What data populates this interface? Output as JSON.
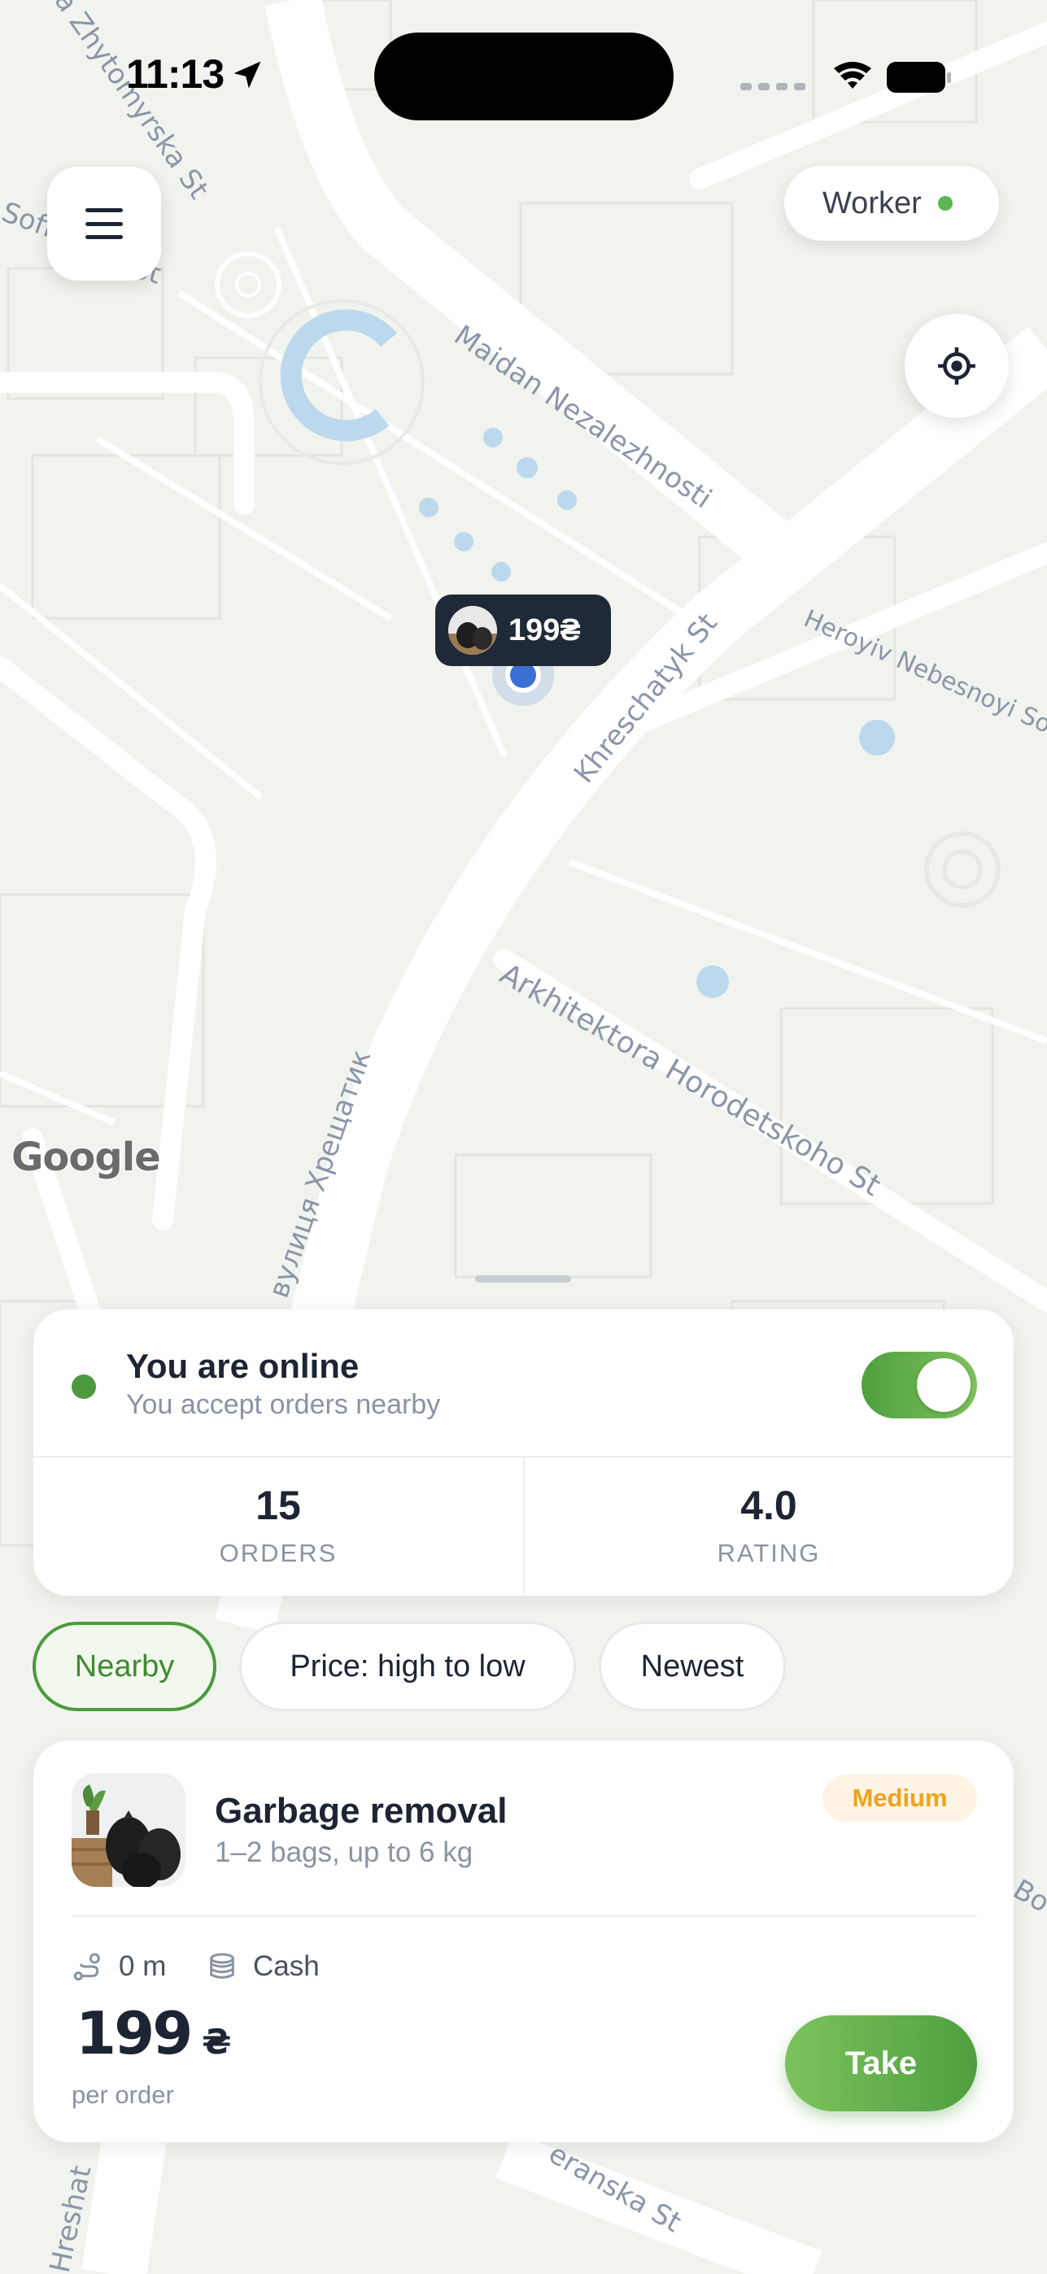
{
  "status_bar": {
    "time": "11:13"
  },
  "header": {
    "role_label": "Worker"
  },
  "map": {
    "streets": [
      "Maidan Nezalezhnosti",
      "Khreschatyk St",
      "Heroyiv Nebesnoyi Sot",
      "Arkhitektora Horodetskoho St",
      "вулиця Хрещатик",
      "a Zhytomyrska St",
      "Sofi",
      "St",
      "Bo",
      "Hreshat",
      "eranska St"
    ],
    "provider": "Google",
    "marker": {
      "price": "199₴"
    }
  },
  "status_card": {
    "title": "You are online",
    "subtitle": "You accept orders nearby",
    "toggle_on": true,
    "stats": [
      {
        "value": "15",
        "label": "ORDERS"
      },
      {
        "value": "4.0",
        "label": "RATING"
      }
    ]
  },
  "filters": [
    {
      "label": "Nearby",
      "active": true
    },
    {
      "label": "Price: high to low",
      "active": false
    },
    {
      "label": "Newest",
      "active": false
    }
  ],
  "order": {
    "title": "Garbage removal",
    "subtitle": "1–2 bags, up to 6 kg",
    "badge": "Medium",
    "distance": "0 m",
    "payment": "Cash",
    "price": "199",
    "currency": "₴",
    "price_caption": "per order",
    "action_label": "Take"
  },
  "colors": {
    "accent_green": "#4c9a3e",
    "badge_orange": "#f0a21c",
    "map_background": "#f1f3ee",
    "dark_text": "#1d2433"
  }
}
